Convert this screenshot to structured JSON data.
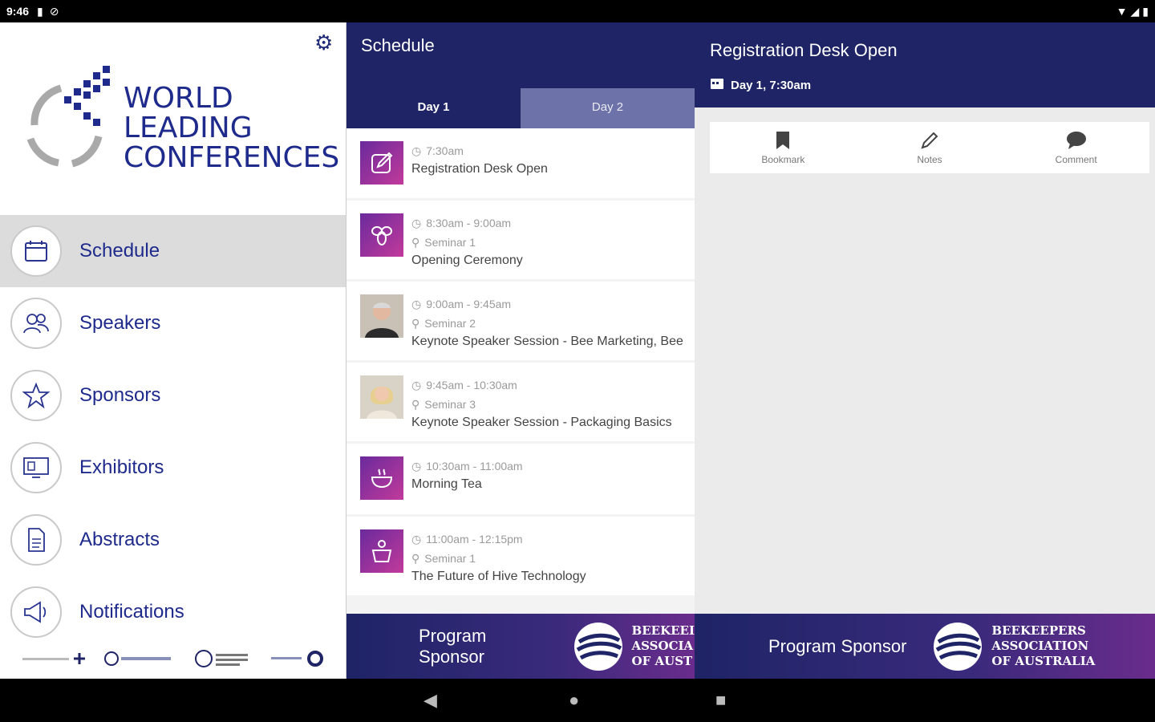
{
  "status_bar": {
    "time": "9:46"
  },
  "drawer": {
    "logo_lines": [
      "WORLD",
      "LEADING",
      "CONFERENCES"
    ],
    "menu": [
      {
        "label": "Schedule",
        "icon": "calendar-icon",
        "active": true
      },
      {
        "label": "Speakers",
        "icon": "people-icon",
        "active": false
      },
      {
        "label": "Sponsors",
        "icon": "star-icon",
        "active": false
      },
      {
        "label": "Exhibitors",
        "icon": "display-icon",
        "active": false
      },
      {
        "label": "Abstracts",
        "icon": "document-icon",
        "active": false
      },
      {
        "label": "Notifications",
        "icon": "megaphone-icon",
        "active": false
      }
    ]
  },
  "schedule": {
    "title": "Schedule",
    "tabs": [
      {
        "label": "Day 1",
        "active": true
      },
      {
        "label": "Day 2",
        "active": false
      }
    ],
    "items": [
      {
        "time": "7:30am",
        "location": "",
        "title": "Registration Desk Open",
        "thumb": "edit-icon"
      },
      {
        "time": "8:30am - 9:00am",
        "location": "Seminar 1",
        "title": "Opening Ceremony",
        "thumb": "bee-icon"
      },
      {
        "time": "9:00am - 9:45am",
        "location": "Seminar 2",
        "title": "Keynote Speaker Session - Bee Marketing, Bee",
        "thumb": "speaker-photo-male"
      },
      {
        "time": "9:45am - 10:30am",
        "location": "Seminar 3",
        "title": "Keynote Speaker Session - Packaging Basics",
        "thumb": "speaker-photo-female"
      },
      {
        "time": "10:30am - 11:00am",
        "location": "",
        "title": "Morning Tea",
        "thumb": "teacup-icon"
      },
      {
        "time": "11:00am - 12:15pm",
        "location": "Seminar 1",
        "title": "The Future of Hive Technology",
        "thumb": "podium-icon"
      }
    ],
    "sponsor": {
      "label": "Program Sponsor",
      "name_lines": [
        "BEEKEEI",
        "ASSOCIA",
        "OF AUST"
      ]
    }
  },
  "detail": {
    "title": "Registration Desk Open",
    "subtitle": "Day 1, 7:30am",
    "actions": [
      {
        "label": "Bookmark",
        "icon": "bookmark-icon"
      },
      {
        "label": "Notes",
        "icon": "pencil-icon"
      },
      {
        "label": "Comment",
        "icon": "comment-icon"
      }
    ],
    "sponsor": {
      "label": "Program Sponsor",
      "name_lines": [
        "BEEKEEPERS",
        "ASSOCIATION",
        "OF AUSTRALIA"
      ]
    }
  },
  "colors": {
    "brand_navy": "#1e2466",
    "logo_blue": "#1e2a8c",
    "accent_purple": "#8a2a9c"
  }
}
